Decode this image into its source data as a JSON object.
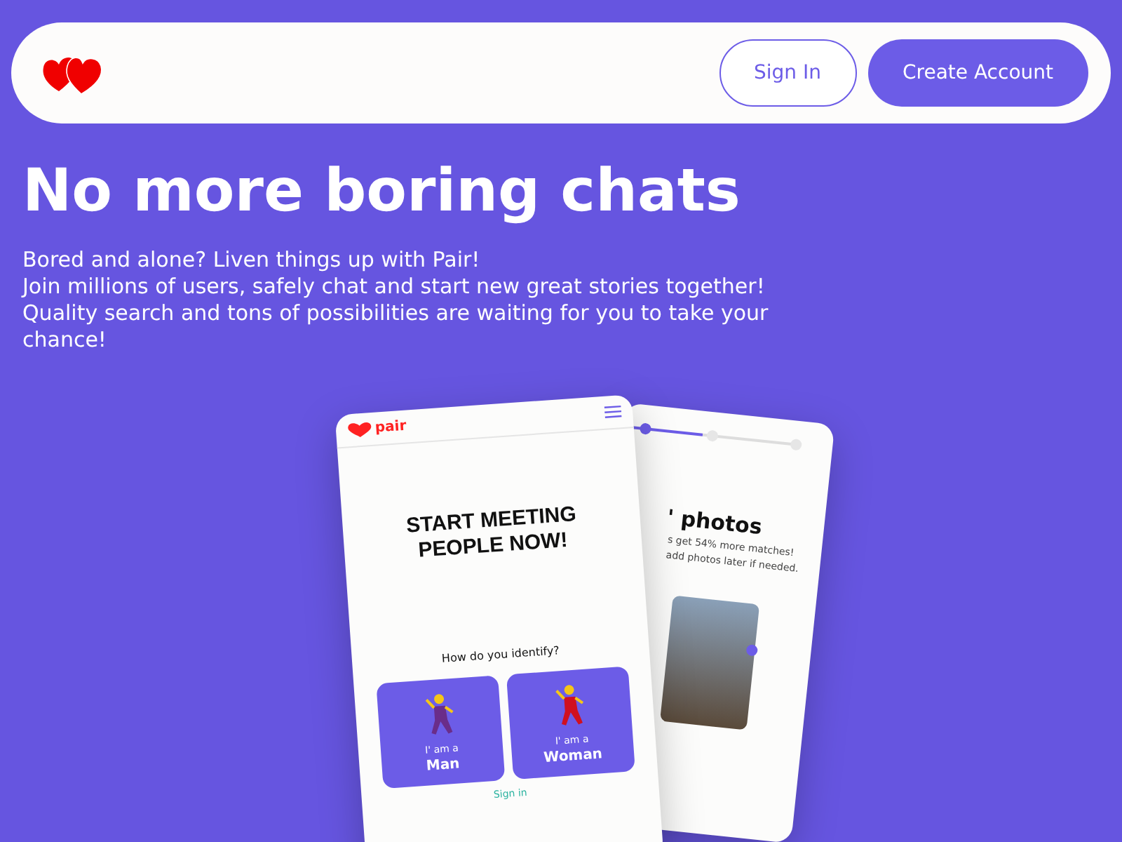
{
  "header": {
    "buttons": [
      {
        "label": "Sign In",
        "kind": "outline"
      },
      {
        "label": "Create Account",
        "kind": "filled"
      }
    ]
  },
  "hero": {
    "title": "No more boring chats",
    "lines": [
      "Bored and alone? Liven things up with Pair!",
      "Join millions of users, safely chat and start new great stories together!",
      "Quality search and tons of possibilities are waiting for you to take your chance!"
    ]
  },
  "front_phone": {
    "brand": "pair",
    "headline": "START MEETING PEOPLE NOW!",
    "question": "How do you identify?",
    "options": [
      {
        "prefix": "I' am a",
        "label": "Man"
      },
      {
        "prefix": "I' am a",
        "label": "Woman"
      }
    ],
    "footer_link": "Sign in"
  },
  "back_phone": {
    "title": "' photos",
    "lines": [
      "s get 54% more matches!",
      "add photos later if needed."
    ]
  }
}
